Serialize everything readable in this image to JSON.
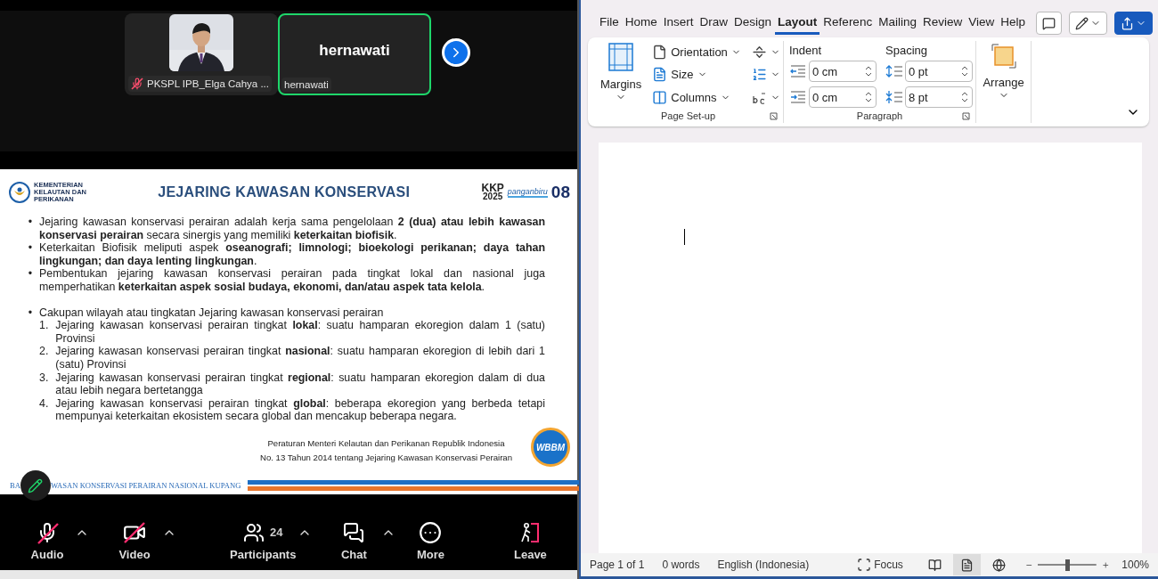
{
  "meeting": {
    "tiles": [
      {
        "name": "PKSPL IPB_Elga Cahya ...",
        "muted": true,
        "speaking": false
      },
      {
        "kind": "initials",
        "display": "hernawati",
        "name": "hernawati",
        "muted": false,
        "speaking": true
      }
    ],
    "slide": {
      "ministry": [
        "KEMENTERIAN",
        "KELAUTAN DAN",
        "PERIKANAN"
      ],
      "title": "JEJARING KAWASAN KONSERVASI",
      "logos": [
        {
          "kind": "kkp",
          "text": "KKP",
          "sub": "2025"
        },
        {
          "kind": "pangan",
          "text": "panganbiru"
        },
        {
          "kind": "eight",
          "text": "08"
        }
      ],
      "bullets": [
        {
          "marker": "•",
          "text": "Jejaring kawasan konservasi perairan adalah kerja sama pengelolaan **2 (dua) atau lebih kawasan konservasi perairan** secara sinergis yang memiliki **keterkaitan biofisik**.",
          "spaced": false
        },
        {
          "marker": "•",
          "text": "Keterkaitan Biofisik meliputi aspek **oseanografi; limnologi; bioekologi perikanan; daya tahan lingkungan; dan  daya lenting lingkungan**.",
          "spaced": false
        },
        {
          "marker": "•",
          "text": "Pembentukan jejaring kawasan konservasi perairan pada tingkat lokal dan nasional juga memperhatikan **keterkaitan aspek sosial budaya, ekonomi, dan/atau aspek tata kelola**.",
          "spaced": false
        },
        {
          "marker": "•",
          "text": "Cakupan wilayah atau tingkatan Jejaring kawasan konservasi perairan",
          "spaced": true,
          "children": [
            {
              "marker": "1.",
              "text": "Jejaring kawasan konservasi perairan tingkat **lokal**: suatu hamparan ekoregion dalam 1 (satu) Provinsi"
            },
            {
              "marker": "2.",
              "text": "Jejaring kawasan konservasi perairan tingkat **nasional**: suatu hamparan ekoregion di lebih dari 1 (satu) Provinsi"
            },
            {
              "marker": "3.",
              "text": "Jejaring kawasan konservasi perairan tingkat **regional**: suatu hamparan ekoregion dalam di dua atau lebih negara bertetangga"
            },
            {
              "marker": "4.",
              "text": "Jejaring kawasan konservasi perairan tingkat **global**: beberapa ekoregion yang berbeda tetapi mempunyai keterkaitan ekosistem secara global dan mencakup beberapa negara."
            }
          ]
        }
      ],
      "reference": [
        "Peraturan Menteri Kelautan dan Perikanan Republik Indonesia",
        "No. 13 Tahun 2014 tentang Jejaring Kawasan Konservasi Perairan"
      ],
      "badge": "WBBM",
      "footer": [
        "BA",
        "WASAN KONSERVASI PERAIRAN NASIONAL KUPANG"
      ]
    },
    "toolbar": [
      {
        "kind": "audio",
        "label": "Audio",
        "off": true,
        "caret": true
      },
      {
        "kind": "video",
        "label": "Video",
        "off": true,
        "caret": true
      },
      {
        "kind": "participants",
        "label": "Participants",
        "count": "24",
        "caret": true
      },
      {
        "kind": "chat",
        "label": "Chat",
        "caret": true
      },
      {
        "kind": "more",
        "label": "More",
        "caret": false
      },
      {
        "kind": "leave",
        "label": "Leave",
        "caret": false
      }
    ]
  },
  "word": {
    "tabs": [
      {
        "label": "File",
        "selected": false
      },
      {
        "label": "Home",
        "selected": false
      },
      {
        "label": "Insert",
        "selected": false
      },
      {
        "label": "Draw",
        "selected": false
      },
      {
        "label": "Design",
        "selected": false
      },
      {
        "label": "Layout",
        "selected": true
      },
      {
        "label": "Referenc",
        "selected": false
      },
      {
        "label": "Mailing",
        "selected": false
      },
      {
        "label": "Review",
        "selected": false
      },
      {
        "label": "View",
        "selected": false
      },
      {
        "label": "Help",
        "selected": false
      }
    ],
    "page_setup": {
      "margins": "Margins",
      "items": [
        {
          "kind": "orientation",
          "label": "Orientation"
        },
        {
          "kind": "size",
          "label": "Size"
        },
        {
          "kind": "columns",
          "label": "Columns"
        }
      ],
      "group": "Page Set-up"
    },
    "paragraph": {
      "indent": "Indent",
      "spacing": "Spacing",
      "indent_fields": [
        "0 cm",
        "0 cm"
      ],
      "spacing_fields": [
        "0 pt",
        "8 pt"
      ],
      "group": "Paragraph"
    },
    "arrange": "Arrange",
    "status": {
      "page": "Page 1 of 1",
      "words": "0 words",
      "language": "English (Indonesia)",
      "focus": "Focus",
      "views": [
        {
          "kind": "read",
          "selected": false
        },
        {
          "kind": "print",
          "selected": true
        },
        {
          "kind": "web",
          "selected": false
        }
      ],
      "zoom": {
        "level": 0.5,
        "reading": "100%"
      }
    }
  }
}
